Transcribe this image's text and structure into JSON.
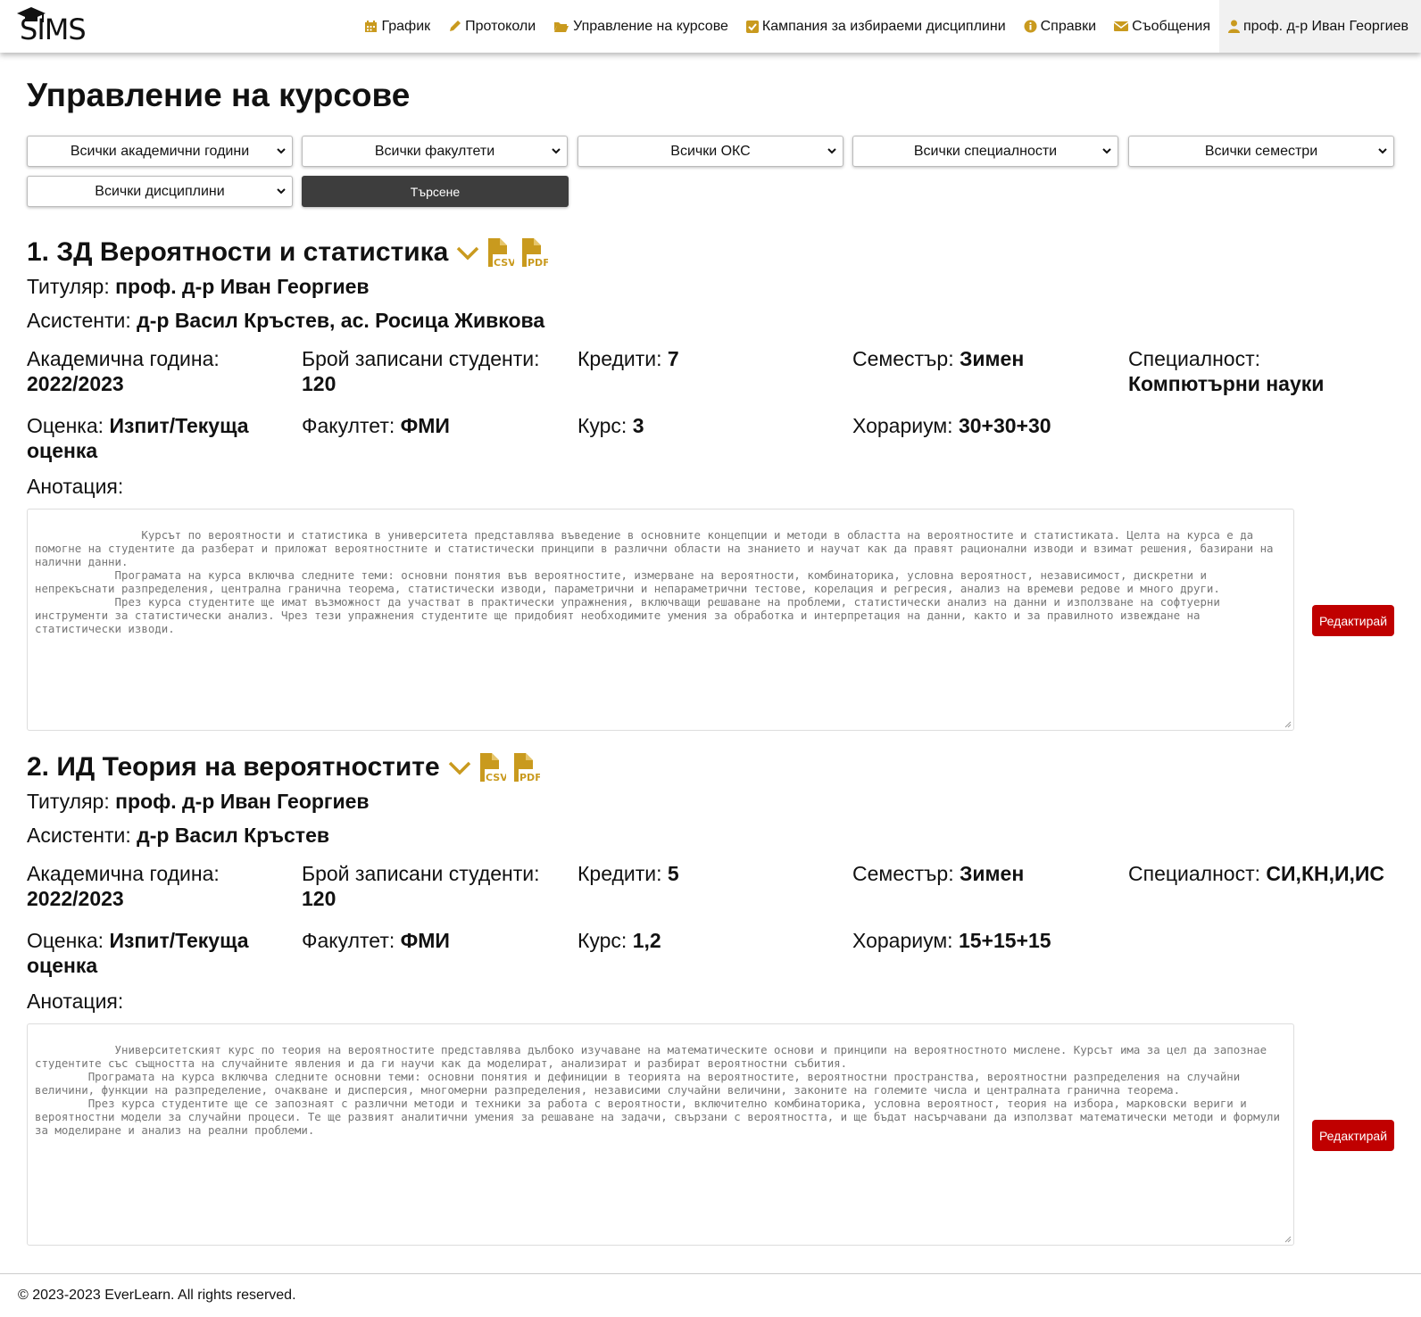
{
  "app": {
    "logo_text": "SIMS"
  },
  "nav": {
    "items": [
      {
        "label": "График",
        "icon": "calendar-icon"
      },
      {
        "label": "Протоколи",
        "icon": "pencil-icon"
      },
      {
        "label": "Управление на курсове",
        "icon": "folder-open-icon"
      },
      {
        "label": "Кампания за избираеми дисциплини",
        "icon": "check-square-icon"
      },
      {
        "label": "Справки",
        "icon": "info-circle-icon"
      },
      {
        "label": "Съобщения",
        "icon": "envelope-icon"
      }
    ],
    "user": {
      "label": "проф. д-р Иван Георгиев",
      "icon": "user-icon"
    }
  },
  "page": {
    "title": "Управление на курсове"
  },
  "filters": {
    "academic_year": "Всички академични години",
    "faculty": "Всички факултети",
    "degree": "Всички ОКС",
    "specialty": "Всички специалности",
    "semester": "Всички семестри",
    "discipline": "Всички дисциплини",
    "search_label": "Търсене"
  },
  "labels": {
    "titular": "Титуляр:",
    "assistants": "Асистенти:",
    "academic_year": "Академична година:",
    "enrolled": "Брой записани студенти:",
    "credits": "Кредити:",
    "semester": "Семестър:",
    "specialty": "Специалност:",
    "grading": "Оценка:",
    "faculty": "Факултет:",
    "course_year": "Курс:",
    "hours": "Хорариум:",
    "annotation": "Анотация:",
    "edit": "Редактирай",
    "csv": "CSV",
    "pdf": "PDF"
  },
  "courses": [
    {
      "title": "1. ЗД Вероятности и статистика",
      "titular": "проф. д-р Иван Георгиев",
      "assistants": "д-р Васил Кръстев, ас. Росица Живкова",
      "academic_year": "2022/2023",
      "enrolled": "120",
      "credits": "7",
      "semester": "Зимен",
      "specialty": "Компютърни науки",
      "grading": "Изпит/Текуща оценка",
      "faculty": "ФМИ",
      "course_year": "3",
      "hours": "30+30+30",
      "annotation": "            Курсът по вероятности и статистика в университета представлява въведение в основните концепции и методи в областта на вероятностите и статистиката. Целта на курса е да помогне на студентите да разберат и приложат вероятностните и статистически принципи в различни области на знанието и научат как да правят рационални изводи и взимат решения, базирани на налични данни.\n            Програмата на курса включва следните теми: основни понятия във вероятностите, измерване на вероятности, комбинаторика, условна вероятност, независимост, дискретни и непрекъснати разпределения, централна гранична теорема, статистически изводи, параметрични и непараметрични тестове, корелация и регресия, анализ на времеви редове и много други.\n            През курса студентите ще имат възможност да участват в практически упражнения, включващи решаване на проблеми, статистически анализ на данни и използване на софтуерни инструменти за статистически анализ. Чрез тези упражнения студентите ще придобият необходимите умения за обработка и интерпретация на данни, както и за правилното извеждане на статистически изводи."
    },
    {
      "title": "2. ИД Теория на вероятностите",
      "titular": "проф. д-р Иван Георгиев",
      "assistants": "д-р Васил Кръстев",
      "academic_year": "2022/2023",
      "enrolled": "120",
      "credits": "5",
      "semester": "Зимен",
      "specialty": "СИ,КН,И,ИС",
      "grading": "Изпит/Текуща оценка",
      "faculty": "ФМИ",
      "course_year": "1,2",
      "hours": "15+15+15",
      "annotation": "        Университетският курс по теория на вероятностите представлява дълбоко изучаване на математическите основи и принципи на вероятностното мислене. Курсът има за цел да запознае студентите със същността на случайните явления и да ги научи как да моделират, анализират и разбират вероятностни събития.\n        Програмата на курса включва следните основни теми: основни понятия и дефиниции в теорията на вероятностите, вероятностни пространства, вероятностни разпределения на случайни величини, функции на разпределение, очакване и дисперсия, многомерни разпределения, независими случайни величини, законите на големите числа и централната гранична теорема.\n        През курса студентите ще се запознаят с различни методи и техники за работа с вероятности, включително комбинаторика, условна вероятност, теория на избора, марковски вериги и вероятностни модели за случайни процеси. Те ще развият аналитични умения за решаване на задачи, свързани с вероятността, и ще бъдат насърчавани да използват математически методи и формули за моделиране и анализ на реални проблеми."
    }
  ],
  "footer": {
    "text": "© 2023-2023 EverLearn. All rights reserved."
  },
  "colors": {
    "accent_gold": "#c99a1e",
    "edit_red": "#c00000",
    "search_dark": "#3d3d3d"
  }
}
